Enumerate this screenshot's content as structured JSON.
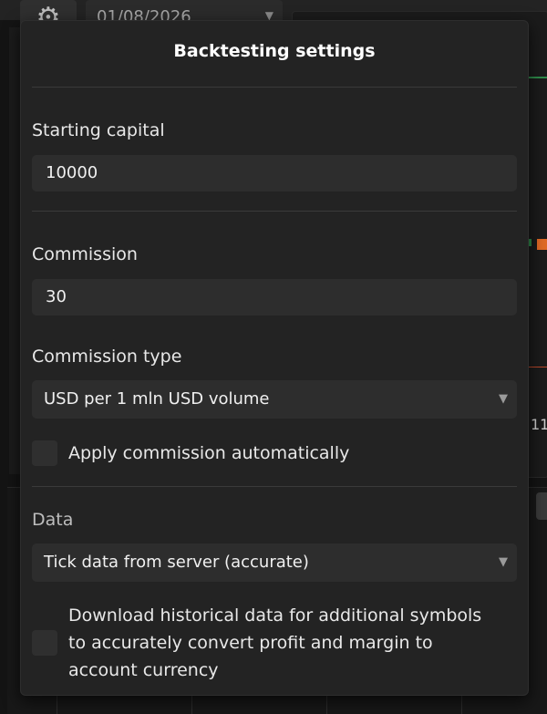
{
  "background": {
    "date_value": "01/08/2026",
    "tick_label": "11"
  },
  "popup": {
    "title": "Backtesting settings",
    "starting_capital": {
      "label": "Starting capital",
      "value": "10000"
    },
    "commission": {
      "label": "Commission",
      "value": "30"
    },
    "commission_type": {
      "label": "Commission type",
      "selected": "USD per 1 mln USD volume"
    },
    "apply_commission": {
      "label": "Apply commission automatically",
      "checked": false
    },
    "data": {
      "label": "Data",
      "selected": "Tick data from server (accurate)"
    },
    "download_historical": {
      "line1": "Download historical data for additional symbols",
      "line2": "to accurately convert profit and margin to",
      "line3": "account currency",
      "checked": false
    }
  },
  "colors": {
    "popup_bg": "#232323",
    "field_bg": "#2d2d2d",
    "text": "#e8e8e8",
    "accent_green": "#2e8b4a",
    "accent_orange": "#e06a26"
  },
  "icons": {
    "settings": "gear-icon",
    "dropdown": "chevron-down-icon"
  }
}
